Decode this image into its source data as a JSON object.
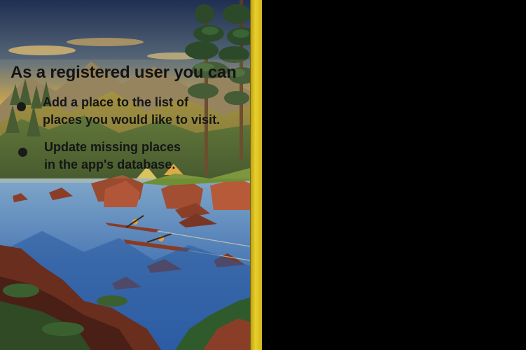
{
  "slide": {
    "heading": "As a registered user you can",
    "bullets": [
      {
        "line1": "Add a place to the list of",
        "line2": "places you would like to visit."
      },
      {
        "line1": "Update missing places",
        "line2": "in the app's database."
      }
    ]
  },
  "colors": {
    "background": "#000000",
    "accent_strip": "#e8cf2c",
    "text": "#141414"
  },
  "illustration": {
    "icon": "lake-landscape-illustration"
  }
}
